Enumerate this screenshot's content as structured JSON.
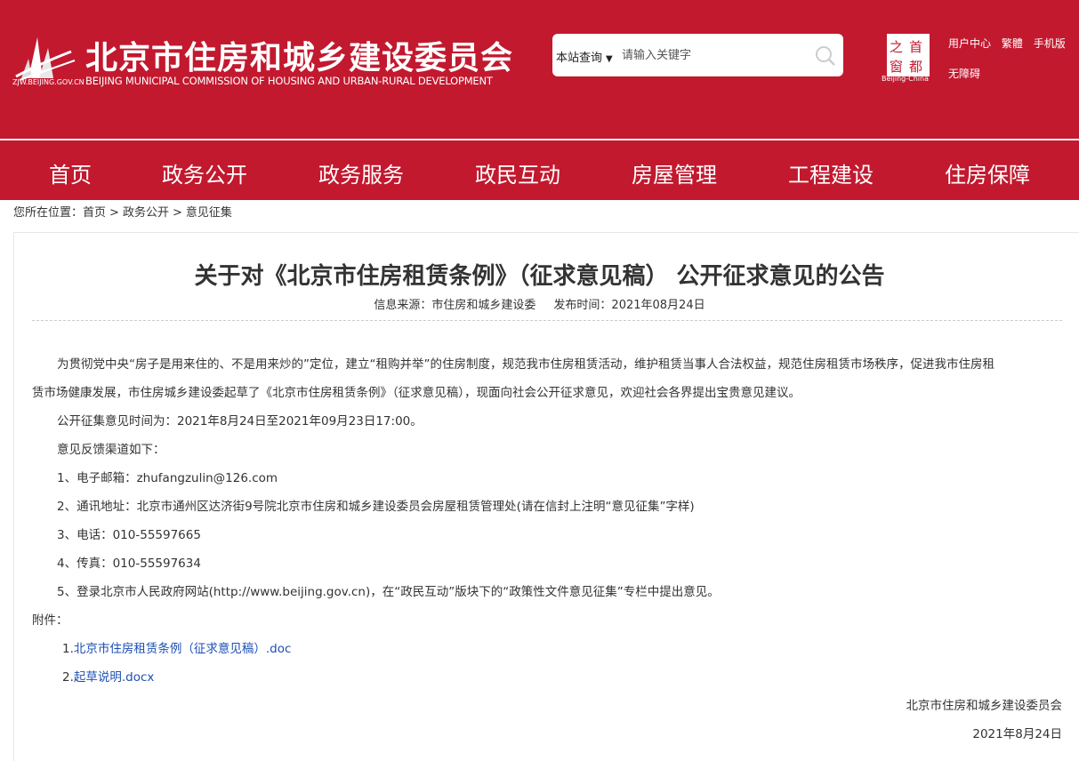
{
  "header": {
    "logo_url": "ZJW.BEIJING.GOV.CN",
    "title": "北京市住房和城乡建设委员会",
    "subtitle": "BEIJING MUNICIPAL COMMISSION OF HOUSING AND URBAN-RURAL DEVELOPMENT",
    "search_scope": "本站查询",
    "search_placeholder": "请输入关键字",
    "capital_logo_text": [
      "首",
      "都",
      "之",
      "窗"
    ],
    "capital_logo_tag": "Beijing-China",
    "links": [
      "用户中心",
      "繁體",
      "手机版"
    ],
    "accessibility": "无障碍"
  },
  "colors": {
    "brand": "#c2192f",
    "link": "#1b4fb4"
  },
  "nav": [
    "首页",
    "政务公开",
    "政务服务",
    "政民互动",
    "房屋管理",
    "工程建设",
    "住房保障"
  ],
  "breadcrumb": {
    "prefix": "您所在位置：",
    "items": [
      "首页",
      "政务公开",
      "意见征集"
    ],
    "separator": ">"
  },
  "article": {
    "title": "关于对《北京市住房租赁条例》（征求意见稿） 公开征求意见的公告",
    "source_label": "信息来源：市住房和城乡建设委",
    "date_label": "发布时间：2021年08月24日",
    "intro_line1": "为贯彻党中央“房子是用来住的、不是用来炒的”定位，建立“租购并举”的住房制度，规范我市住房租赁活动，维护租赁当事人合法权益，规范住房租赁市场秩序，促进我市住房租",
    "intro_line2": "赁市场健康发展，市住房城乡建设委起草了《北京市住房租赁条例》（征求意见稿），现面向社会公开征求意见，欢迎社会各界提出宝贵意见建议。",
    "period": "公开征集意见时间为：2021年8月24日至2021年09月23日17:00。",
    "channels_label": "意见反馈渠道如下：",
    "channels": [
      "1、电子邮箱：zhufangzulin@126.com",
      "2、通讯地址：北京市通州区达济街9号院北京市住房和城乡建设委员会房屋租赁管理处(请在信封上注明“意见征集”字样)",
      "3、电话：010-55597665",
      "4、传真：010-55597634",
      "5、登录北京市人民政府网站(http://www.beijing.gov.cn)，在“政民互动”版块下的“政策性文件意见征集”专栏中提出意见。"
    ],
    "attachments_label": "附件：",
    "attachments": [
      {
        "num": "1.",
        "name": "北京市住房租赁条例（征求意见稿）.doc"
      },
      {
        "num": "2.",
        "name": "起草说明.docx"
      }
    ],
    "signature": "北京市住房和城乡建设委员会",
    "sign_date": "2021年8月24日"
  }
}
